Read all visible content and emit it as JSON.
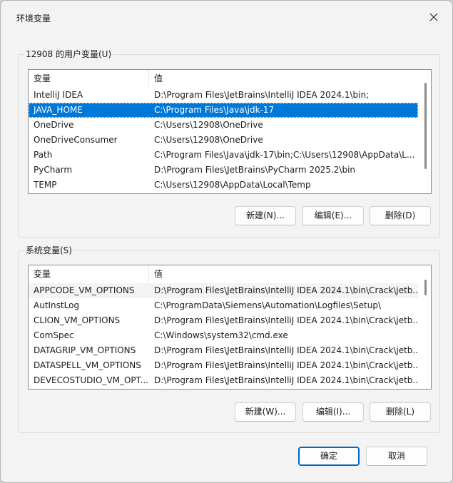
{
  "window": {
    "title": "环境变量"
  },
  "user_vars": {
    "group_label": "12908 的用户变量(U)",
    "columns": [
      "变量",
      "值"
    ],
    "rows": [
      {
        "name": "IntelliJ IDEA",
        "value": "D:\\Program Files\\JetBrains\\IntelliJ IDEA 2024.1\\bin;"
      },
      {
        "name": "JAVA_HOME",
        "value": "C:\\Program Files\\Java\\jdk-17"
      },
      {
        "name": "OneDrive",
        "value": "C:\\Users\\12908\\OneDrive"
      },
      {
        "name": "OneDriveConsumer",
        "value": "C:\\Users\\12908\\OneDrive"
      },
      {
        "name": "Path",
        "value": "C:\\Program Files\\Java\\jdk-17\\bin;C:\\Users\\12908\\AppData\\L..."
      },
      {
        "name": "PyCharm",
        "value": "D:\\Program Files\\JetBrains\\PyCharm 2025.2\\bin"
      },
      {
        "name": "TEMP",
        "value": "C:\\Users\\12908\\AppData\\Local\\Temp"
      }
    ],
    "selected_index": 1,
    "buttons": {
      "new": "新建(N)...",
      "edit": "编辑(E)...",
      "delete": "删除(D)"
    }
  },
  "system_vars": {
    "group_label": "系统变量(S)",
    "columns": [
      "变量",
      "值"
    ],
    "rows": [
      {
        "name": "APPCODE_VM_OPTIONS",
        "value": "D:\\Program Files\\JetBrains\\IntelliJ IDEA 2024.1\\bin\\Crack\\jetb..."
      },
      {
        "name": "AutInstLog",
        "value": "C:\\ProgramData\\Siemens\\Automation\\Logfiles\\Setup\\"
      },
      {
        "name": "CLION_VM_OPTIONS",
        "value": "D:\\Program Files\\JetBrains\\IntelliJ IDEA 2024.1\\bin\\Crack\\jetb..."
      },
      {
        "name": "ComSpec",
        "value": "C:\\Windows\\system32\\cmd.exe"
      },
      {
        "name": "DATAGRIP_VM_OPTIONS",
        "value": "D:\\Program Files\\JetBrains\\IntelliJ IDEA 2024.1\\bin\\Crack\\jetb..."
      },
      {
        "name": "DATASPELL_VM_OPTIONS",
        "value": "D:\\Program Files\\JetBrains\\IntelliJ IDEA 2024.1\\bin\\Crack\\jetb..."
      },
      {
        "name": "DEVECOSTUDIO_VM_OPT...",
        "value": "D:\\Program Files\\JetBrains\\IntelliJ IDEA 2024.1\\bin\\Crack\\jetb..."
      }
    ],
    "hovered_index": 0,
    "buttons": {
      "new": "新建(W)...",
      "edit": "编辑(I)...",
      "delete": "删除(L)"
    }
  },
  "footer": {
    "ok": "确定",
    "cancel": "取消"
  },
  "colors": {
    "selection": "#0078d7",
    "primary_border": "#0067c0",
    "dialog_bg": "#f3f3f3"
  },
  "icons": {
    "close": "close-icon"
  }
}
